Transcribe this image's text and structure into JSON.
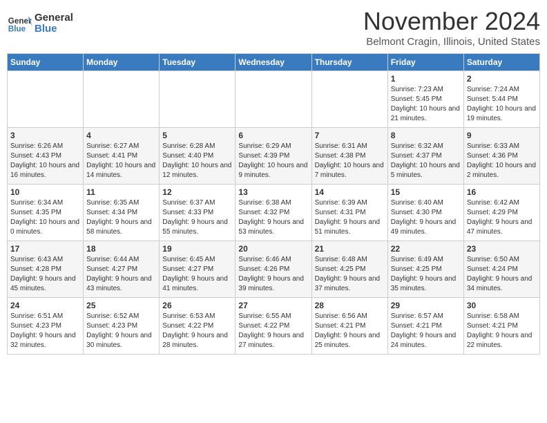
{
  "header": {
    "logo_line1": "General",
    "logo_line2": "Blue",
    "month_title": "November 2024",
    "location": "Belmont Cragin, Illinois, United States"
  },
  "weekdays": [
    "Sunday",
    "Monday",
    "Tuesday",
    "Wednesday",
    "Thursday",
    "Friday",
    "Saturday"
  ],
  "weeks": [
    [
      {
        "day": "",
        "info": ""
      },
      {
        "day": "",
        "info": ""
      },
      {
        "day": "",
        "info": ""
      },
      {
        "day": "",
        "info": ""
      },
      {
        "day": "",
        "info": ""
      },
      {
        "day": "1",
        "info": "Sunrise: 7:23 AM\nSunset: 5:45 PM\nDaylight: 10 hours and 21 minutes."
      },
      {
        "day": "2",
        "info": "Sunrise: 7:24 AM\nSunset: 5:44 PM\nDaylight: 10 hours and 19 minutes."
      }
    ],
    [
      {
        "day": "3",
        "info": "Sunrise: 6:26 AM\nSunset: 4:43 PM\nDaylight: 10 hours and 16 minutes."
      },
      {
        "day": "4",
        "info": "Sunrise: 6:27 AM\nSunset: 4:41 PM\nDaylight: 10 hours and 14 minutes."
      },
      {
        "day": "5",
        "info": "Sunrise: 6:28 AM\nSunset: 4:40 PM\nDaylight: 10 hours and 12 minutes."
      },
      {
        "day": "6",
        "info": "Sunrise: 6:29 AM\nSunset: 4:39 PM\nDaylight: 10 hours and 9 minutes."
      },
      {
        "day": "7",
        "info": "Sunrise: 6:31 AM\nSunset: 4:38 PM\nDaylight: 10 hours and 7 minutes."
      },
      {
        "day": "8",
        "info": "Sunrise: 6:32 AM\nSunset: 4:37 PM\nDaylight: 10 hours and 5 minutes."
      },
      {
        "day": "9",
        "info": "Sunrise: 6:33 AM\nSunset: 4:36 PM\nDaylight: 10 hours and 2 minutes."
      }
    ],
    [
      {
        "day": "10",
        "info": "Sunrise: 6:34 AM\nSunset: 4:35 PM\nDaylight: 10 hours and 0 minutes."
      },
      {
        "day": "11",
        "info": "Sunrise: 6:35 AM\nSunset: 4:34 PM\nDaylight: 9 hours and 58 minutes."
      },
      {
        "day": "12",
        "info": "Sunrise: 6:37 AM\nSunset: 4:33 PM\nDaylight: 9 hours and 55 minutes."
      },
      {
        "day": "13",
        "info": "Sunrise: 6:38 AM\nSunset: 4:32 PM\nDaylight: 9 hours and 53 minutes."
      },
      {
        "day": "14",
        "info": "Sunrise: 6:39 AM\nSunset: 4:31 PM\nDaylight: 9 hours and 51 minutes."
      },
      {
        "day": "15",
        "info": "Sunrise: 6:40 AM\nSunset: 4:30 PM\nDaylight: 9 hours and 49 minutes."
      },
      {
        "day": "16",
        "info": "Sunrise: 6:42 AM\nSunset: 4:29 PM\nDaylight: 9 hours and 47 minutes."
      }
    ],
    [
      {
        "day": "17",
        "info": "Sunrise: 6:43 AM\nSunset: 4:28 PM\nDaylight: 9 hours and 45 minutes."
      },
      {
        "day": "18",
        "info": "Sunrise: 6:44 AM\nSunset: 4:27 PM\nDaylight: 9 hours and 43 minutes."
      },
      {
        "day": "19",
        "info": "Sunrise: 6:45 AM\nSunset: 4:27 PM\nDaylight: 9 hours and 41 minutes."
      },
      {
        "day": "20",
        "info": "Sunrise: 6:46 AM\nSunset: 4:26 PM\nDaylight: 9 hours and 39 minutes."
      },
      {
        "day": "21",
        "info": "Sunrise: 6:48 AM\nSunset: 4:25 PM\nDaylight: 9 hours and 37 minutes."
      },
      {
        "day": "22",
        "info": "Sunrise: 6:49 AM\nSunset: 4:25 PM\nDaylight: 9 hours and 35 minutes."
      },
      {
        "day": "23",
        "info": "Sunrise: 6:50 AM\nSunset: 4:24 PM\nDaylight: 9 hours and 34 minutes."
      }
    ],
    [
      {
        "day": "24",
        "info": "Sunrise: 6:51 AM\nSunset: 4:23 PM\nDaylight: 9 hours and 32 minutes."
      },
      {
        "day": "25",
        "info": "Sunrise: 6:52 AM\nSunset: 4:23 PM\nDaylight: 9 hours and 30 minutes."
      },
      {
        "day": "26",
        "info": "Sunrise: 6:53 AM\nSunset: 4:22 PM\nDaylight: 9 hours and 28 minutes."
      },
      {
        "day": "27",
        "info": "Sunrise: 6:55 AM\nSunset: 4:22 PM\nDaylight: 9 hours and 27 minutes."
      },
      {
        "day": "28",
        "info": "Sunrise: 6:56 AM\nSunset: 4:21 PM\nDaylight: 9 hours and 25 minutes."
      },
      {
        "day": "29",
        "info": "Sunrise: 6:57 AM\nSunset: 4:21 PM\nDaylight: 9 hours and 24 minutes."
      },
      {
        "day": "30",
        "info": "Sunrise: 6:58 AM\nSunset: 4:21 PM\nDaylight: 9 hours and 22 minutes."
      }
    ]
  ]
}
